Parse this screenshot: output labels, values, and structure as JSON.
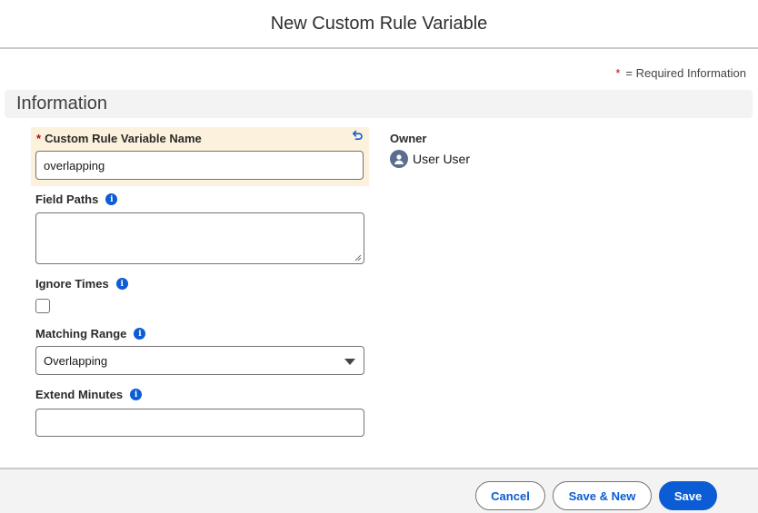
{
  "modal": {
    "title": "New Custom Rule Variable",
    "required_legend_star": "*",
    "required_legend_text": "= Required Information"
  },
  "section": {
    "title": "Information"
  },
  "fields": {
    "name": {
      "required_mark": "*",
      "label": "Custom Rule Variable Name",
      "value": "overlapping"
    },
    "field_paths": {
      "label": "Field Paths",
      "value": ""
    },
    "ignore_times": {
      "label": "Ignore Times",
      "checked": false
    },
    "matching_range": {
      "label": "Matching Range",
      "selected": "Overlapping"
    },
    "extend_minutes": {
      "label": "Extend Minutes",
      "value": ""
    }
  },
  "owner": {
    "label": "Owner",
    "name": "User User"
  },
  "footer": {
    "cancel_label": "Cancel",
    "save_new_label": "Save & New",
    "save_label": "Save"
  },
  "icons": {
    "info": "info-icon",
    "undo": "undo-icon",
    "avatar": "user-avatar-icon",
    "caret": "chevron-down-icon"
  },
  "colors": {
    "brand": "#0b5cd5",
    "required": "#ba0517",
    "highlight": "#fbf1dc",
    "section_bg": "#f3f3f3"
  }
}
